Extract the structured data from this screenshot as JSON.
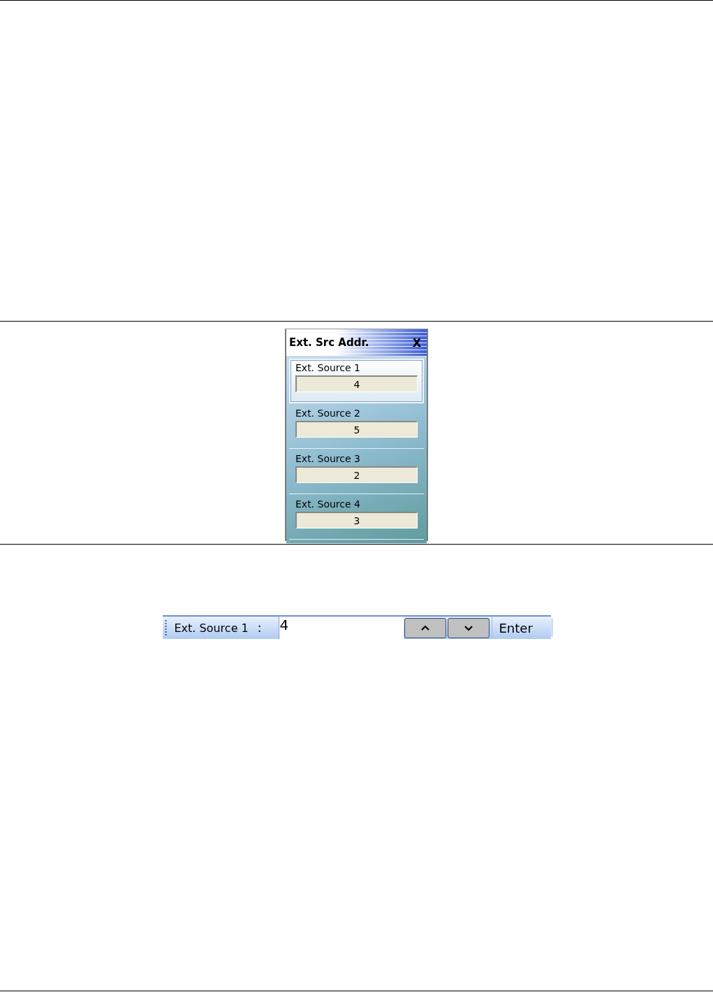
{
  "dialog": {
    "title": "Ext. Src Addr.",
    "close": "X",
    "items": [
      {
        "label": "Ext. Source 1",
        "value": "4",
        "selected": true
      },
      {
        "label": "Ext. Source 2",
        "value": "5",
        "selected": false
      },
      {
        "label": "Ext. Source 3",
        "value": "2",
        "selected": false
      },
      {
        "label": "Ext. Source 4",
        "value": "3",
        "selected": false
      }
    ]
  },
  "entry_bar": {
    "label": "Ext. Source 1",
    "separator": ":",
    "value": "4",
    "buttons": [
      {
        "kind": "up"
      },
      {
        "kind": "down"
      }
    ],
    "enter": "Enter"
  }
}
